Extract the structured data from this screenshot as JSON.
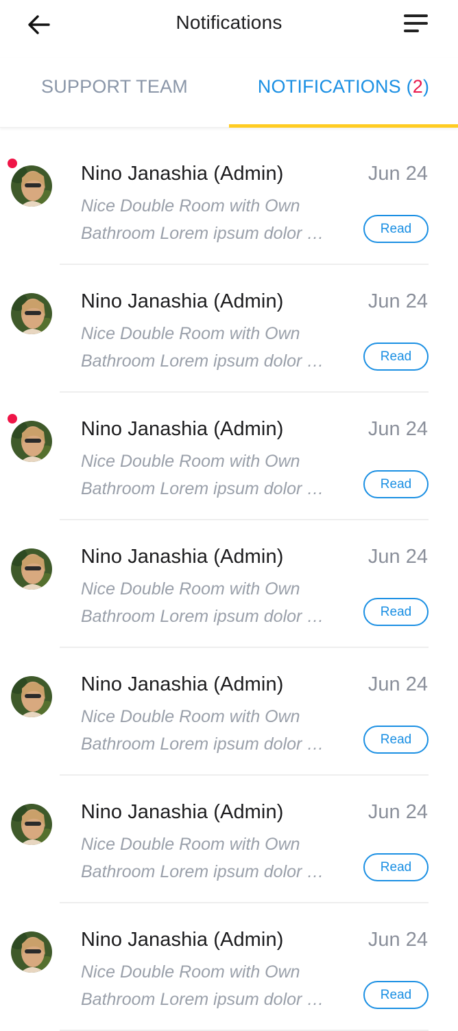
{
  "header": {
    "title": "Notifications",
    "back_icon": "arrow-left-icon",
    "menu_icon": "menu-icon"
  },
  "tabs": {
    "support_label": "SUPPORT TEAM",
    "notifications_label": "NOTIFICATIONS (",
    "notifications_count": "2",
    "notifications_close": ")",
    "active": "notifications"
  },
  "colors": {
    "accent": "#1a8fe3",
    "underline": "#ffcc22",
    "badge": "#ef1547"
  },
  "notifications": [
    {
      "name": "Nino Janashia (Admin)",
      "date": "Jun 24",
      "line1": "Nice Double Room with Own",
      "line2": "Bathroom Lorem ipsum dolor sit amet",
      "button": "Read",
      "unread": true
    },
    {
      "name": "Nino Janashia (Admin)",
      "date": "Jun 24",
      "line1": "Nice Double Room with Own",
      "line2": "Bathroom Lorem ipsum dolor sit amet",
      "button": "Read",
      "unread": false
    },
    {
      "name": "Nino Janashia (Admin)",
      "date": "Jun 24",
      "line1": "Nice Double Room with Own",
      "line2": "Bathroom Lorem ipsum dolor sit amet",
      "button": "Read",
      "unread": true
    },
    {
      "name": "Nino Janashia (Admin)",
      "date": "Jun 24",
      "line1": "Nice Double Room with Own",
      "line2": "Bathroom Lorem ipsum dolor sit amet",
      "button": "Read",
      "unread": false
    },
    {
      "name": "Nino Janashia (Admin)",
      "date": "Jun 24",
      "line1": "Nice Double Room with Own",
      "line2": "Bathroom Lorem ipsum dolor sit amet",
      "button": "Read",
      "unread": false
    },
    {
      "name": "Nino Janashia (Admin)",
      "date": "Jun 24",
      "line1": "Nice Double Room with Own",
      "line2": "Bathroom Lorem ipsum dolor sit amet",
      "button": "Read",
      "unread": false
    },
    {
      "name": "Nino Janashia (Admin)",
      "date": "Jun 24",
      "line1": "Nice Double Room with Own",
      "line2": "Bathroom Lorem ipsum dolor sit amet",
      "button": "Read",
      "unread": false
    }
  ]
}
